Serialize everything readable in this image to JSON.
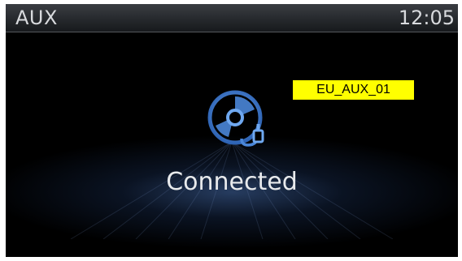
{
  "status_bar": {
    "source_title": "AUX",
    "clock": "12:05"
  },
  "main": {
    "icon": "aux-disc-plug-icon",
    "status_text": "Connected"
  },
  "annotation": {
    "code_label": "EU_AUX_01"
  },
  "colors": {
    "background": "#000000",
    "accent_blue": "#4a86d8",
    "label_highlight": "#ffff00"
  }
}
